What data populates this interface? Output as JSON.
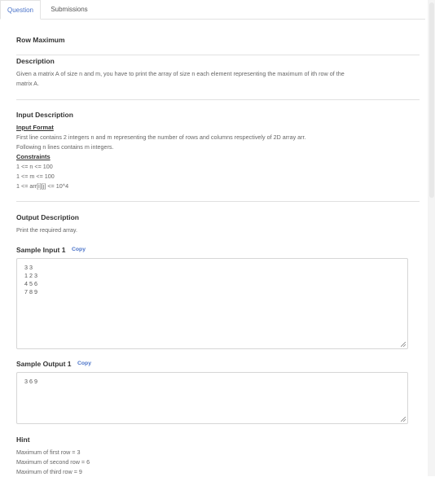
{
  "tabs": [
    {
      "label": "Question",
      "active": true
    },
    {
      "label": "Submissions",
      "active": false
    }
  ],
  "problem": {
    "title": "Row Maximum",
    "description_heading": "Description",
    "description_line1": "Given a matrix A of size n and m, you have to print the array of size n each element representing the maximum of ith row of the",
    "description_line2": "matrix A.",
    "input_heading": "Input Description",
    "input_format_label": "Input Format",
    "input_format_line1": "First line contains 2 integers n and m representing the number of rows and columns respectively of 2D array arr.",
    "input_format_line2": "Following n lines contains m integers.",
    "constraints_label": "Constraints",
    "constraints": [
      "1 <= n <= 100",
      "1 <= m <= 100",
      "1 <= arr[i][j] <= 10^4"
    ],
    "output_heading": "Output Description",
    "output_text": "Print the required array.",
    "sample_input_label": "Sample Input 1",
    "sample_input_value": "3 3\n1 2 3\n4 5 6\n7 8 9",
    "sample_output_label": "Sample Output 1",
    "sample_output_value": "3 6 9",
    "copy_label": "Copy",
    "hint_heading": "Hint",
    "hints": [
      "Maximum of first row = 3",
      "Maximum of second row = 6",
      "Maximum of third row = 9"
    ]
  }
}
